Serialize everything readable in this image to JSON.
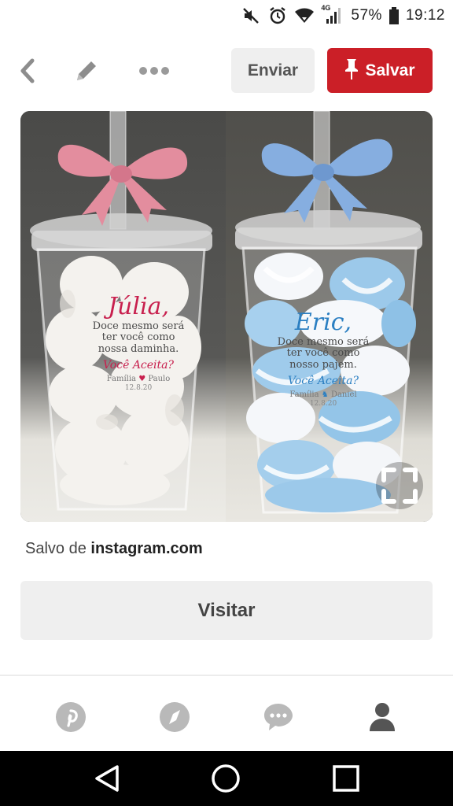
{
  "status_bar": {
    "battery": "57%",
    "time": "19:12",
    "network": "4G",
    "icons": [
      "mute-icon",
      "alarm-icon",
      "wifi-icon",
      "signal-icon",
      "battery-icon"
    ]
  },
  "toolbar": {
    "back_icon": "chevron-left-icon",
    "edit_icon": "pencil-icon",
    "more_icon": "more-dots-icon",
    "send_label": "Enviar",
    "save_label": "Salvar",
    "save_icon": "pin-icon",
    "accent": "#cb1f27"
  },
  "pin": {
    "left_cup": {
      "name": "Júlia,",
      "line1": "Doce mesmo será",
      "line2": "ter você como",
      "line3": "nossa daminha.",
      "question": "Você Aceita?",
      "sign_left": "Família",
      "sign_right": "Paulo",
      "date": "12.8.20",
      "ribbon_color": "#e58a9a",
      "text_color": "#c8204e"
    },
    "right_cup": {
      "name": "Eric,",
      "line1": "Doce mesmo será",
      "line2": "ter você como",
      "line3": "nosso pajem.",
      "question": "Você Aceita?",
      "sign_left": "Família",
      "sign_right": "Daniel",
      "date": "12.8.20",
      "ribbon_color": "#86aee0",
      "text_color": "#2b7fc2"
    },
    "expand_icon": "expand-icon"
  },
  "source": {
    "prefix": "Salvo de",
    "domain": "instagram.com"
  },
  "visit_label": "Visitar",
  "tabs": [
    "pinterest-home-icon",
    "explore-compass-icon",
    "messages-icon",
    "profile-icon"
  ],
  "nav": [
    "back-triangle-icon",
    "home-circle-icon",
    "recents-square-icon"
  ]
}
